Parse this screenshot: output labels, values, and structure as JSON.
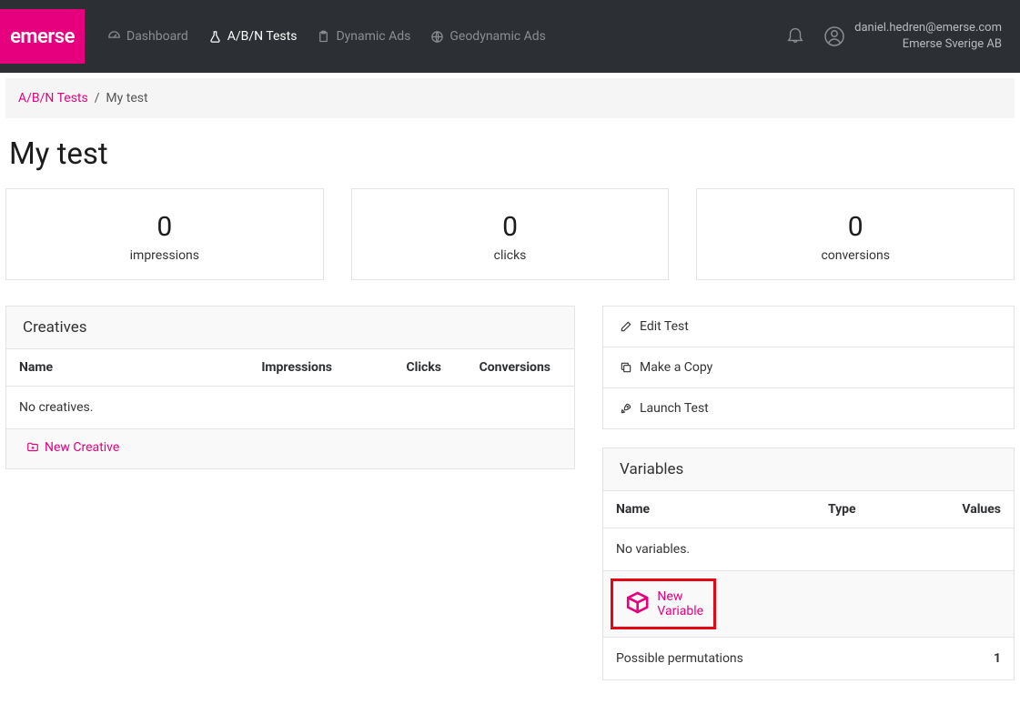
{
  "brand": "emerse",
  "nav": {
    "dashboard": "Dashboard",
    "abn_tests": "A/B/N Tests",
    "dynamic_ads": "Dynamic Ads",
    "geodynamic_ads": "Geodynamic Ads"
  },
  "user": {
    "email": "daniel.hedren@emerse.com",
    "org": "Emerse Sverige AB"
  },
  "breadcrumb": {
    "root": "A/B/N Tests",
    "sep": "/",
    "current": "My test"
  },
  "page_title": "My test",
  "stats": {
    "impressions": {
      "value": "0",
      "label": "impressions"
    },
    "clicks": {
      "value": "0",
      "label": "clicks"
    },
    "conversions": {
      "value": "0",
      "label": "conversions"
    }
  },
  "creatives": {
    "title": "Creatives",
    "cols": {
      "name": "Name",
      "impressions": "Impressions",
      "clicks": "Clicks",
      "conversions": "Conversions"
    },
    "empty": "No creatives.",
    "new_label": "New Creative"
  },
  "actions": {
    "edit": "Edit Test",
    "copy": "Make a Copy",
    "launch": "Launch Test"
  },
  "variables": {
    "title": "Variables",
    "cols": {
      "name": "Name",
      "type": "Type",
      "values": "Values"
    },
    "empty": "No variables.",
    "new_label": "New Variable",
    "perm_label": "Possible permutations",
    "perm_value": "1"
  }
}
